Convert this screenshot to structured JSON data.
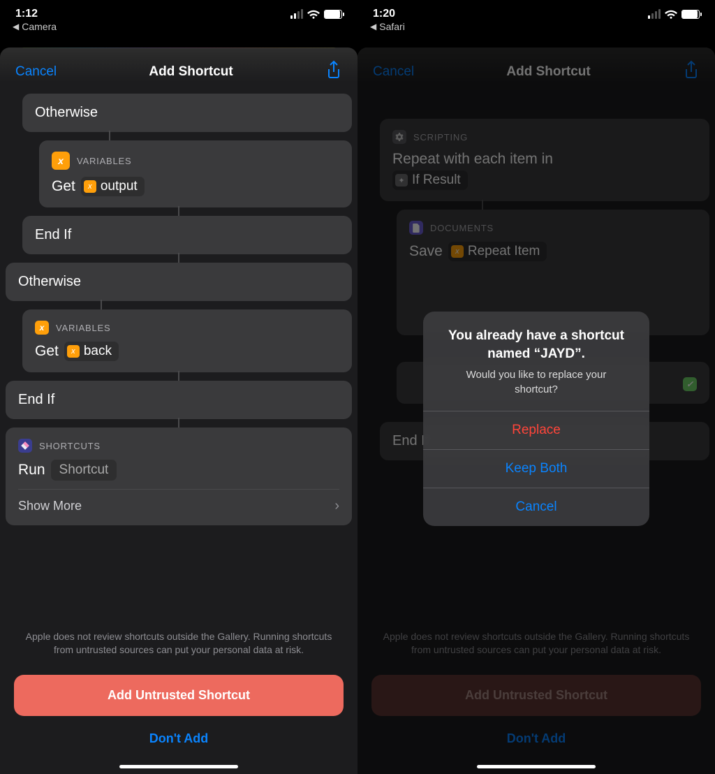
{
  "left": {
    "status": {
      "time": "1:12",
      "back_app": "Camera"
    },
    "nav": {
      "cancel": "Cancel",
      "title": "Add Shortcut"
    },
    "blocks": {
      "otherwise1": "Otherwise",
      "vars1_cat": "VARIABLES",
      "vars1_verb": "Get",
      "vars1_token": "output",
      "endif1": "End If",
      "otherwise2": "Otherwise",
      "vars2_cat": "VARIABLES",
      "vars2_verb": "Get",
      "vars2_token": "back",
      "endif2": "End If",
      "shortcuts_cat": "SHORTCUTS",
      "run_verb": "Run",
      "run_token": "Shortcut",
      "show_more": "Show More"
    },
    "footer": {
      "warning": "Apple does not review shortcuts outside the Gallery. Running shortcuts from untrusted sources can put your personal data at risk.",
      "add": "Add Untrusted Shortcut",
      "dont": "Don't Add"
    }
  },
  "right": {
    "status": {
      "time": "1:20",
      "back_app": "Safari"
    },
    "nav": {
      "cancel": "Cancel",
      "title": "Add Shortcut"
    },
    "blocks": {
      "scripting_cat": "SCRIPTING",
      "repeat_text": "Repeat with each item in",
      "repeat_token": "If Result",
      "docs_cat": "DOCUMENTS",
      "save_verb": "Save",
      "save_token": "Repeat Item",
      "endif": "End If"
    },
    "alert": {
      "title": "You already have a shortcut named “JAYD”.",
      "message": "Would you like to replace your shortcut?",
      "replace": "Replace",
      "keep": "Keep Both",
      "cancel": "Cancel"
    },
    "footer": {
      "warning": "Apple does not review shortcuts outside the Gallery. Running shortcuts from untrusted sources can put your personal data at risk.",
      "add": "Add Untrusted Shortcut",
      "dont": "Don't Add"
    }
  }
}
